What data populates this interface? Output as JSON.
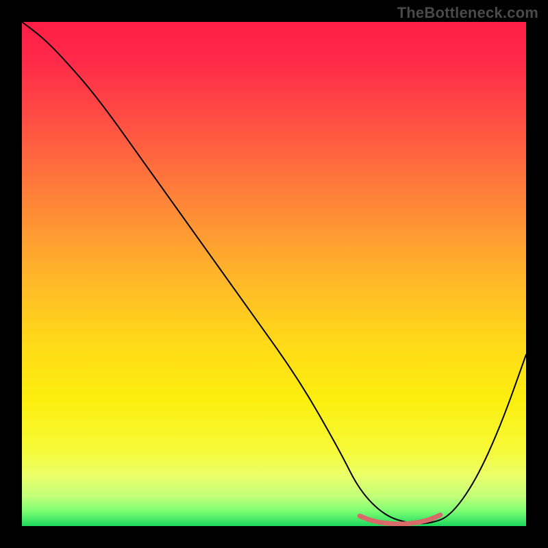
{
  "watermark": "TheBottleneck.com",
  "chart_data": {
    "type": "line",
    "title": "",
    "xlabel": "",
    "ylabel": "",
    "xlim": [
      0,
      100
    ],
    "ylim": [
      0,
      100
    ],
    "grid": false,
    "legend": false,
    "background_gradient": {
      "stops": [
        {
          "offset": 0.0,
          "color": "#ff1e46"
        },
        {
          "offset": 0.08,
          "color": "#ff2b49"
        },
        {
          "offset": 0.2,
          "color": "#ff5043"
        },
        {
          "offset": 0.35,
          "color": "#ff8339"
        },
        {
          "offset": 0.5,
          "color": "#ffb42a"
        },
        {
          "offset": 0.62,
          "color": "#ffd61a"
        },
        {
          "offset": 0.75,
          "color": "#fcef0e"
        },
        {
          "offset": 0.85,
          "color": "#f6fa38"
        },
        {
          "offset": 0.9,
          "color": "#eaff69"
        },
        {
          "offset": 0.94,
          "color": "#c3ff79"
        },
        {
          "offset": 0.97,
          "color": "#7eff73"
        },
        {
          "offset": 1.0,
          "color": "#1dd85e"
        }
      ]
    },
    "series": [
      {
        "name": "bottleneck-curve",
        "color": "#000000",
        "width": 2,
        "x": [
          0,
          4,
          8,
          15,
          25,
          35,
          45,
          55,
          63,
          67,
          72,
          77,
          81,
          85,
          90,
          95,
          100
        ],
        "y": [
          100,
          97,
          93,
          85,
          71,
          57,
          43,
          29,
          15,
          7,
          2,
          0.5,
          0.5,
          2,
          9,
          20,
          34
        ]
      },
      {
        "name": "trough-marker",
        "color": "#d86a6a",
        "width": 7,
        "x": [
          67,
          69,
          71,
          73,
          75,
          77,
          79,
          81,
          83
        ],
        "y": [
          2.0,
          1.2,
          0.7,
          0.5,
          0.4,
          0.5,
          0.8,
          1.3,
          2.2
        ]
      }
    ]
  }
}
